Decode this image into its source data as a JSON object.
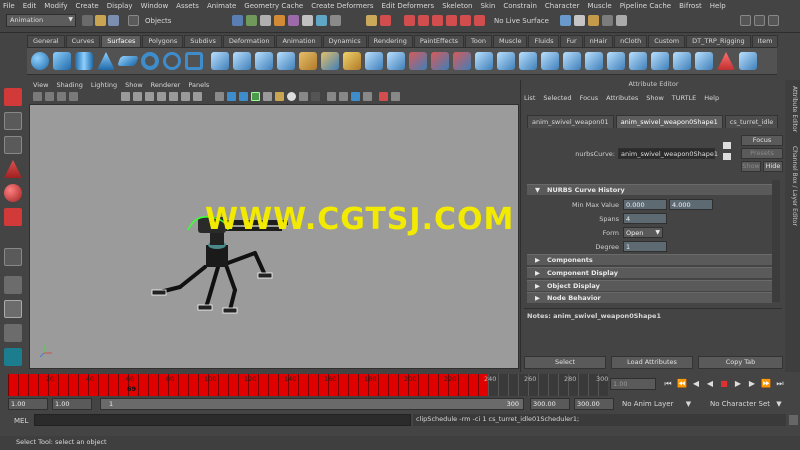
{
  "menubar": [
    "File",
    "Edit",
    "Modify",
    "Create",
    "Display",
    "Window",
    "Assets",
    "Animate",
    "Geometry Cache",
    "Create Deformers",
    "Edit Deformers",
    "Skeleton",
    "Skin",
    "Constrain",
    "Character",
    "Muscle",
    "Pipeline Cache",
    "Bifrost",
    "Help"
  ],
  "status": {
    "mode_menu": "Animation",
    "objects_label": "Objects",
    "live_surface": "No Live Surface"
  },
  "shelf_tabs": [
    "General",
    "Curves",
    "Surfaces",
    "Polygons",
    "Subdivs",
    "Deformation",
    "Animation",
    "Dynamics",
    "Rendering",
    "PaintEffects",
    "Toon",
    "Muscle",
    "Fluids",
    "Fur",
    "nHair",
    "nCloth",
    "Custom",
    "DT_TRP_Rigging",
    "Item"
  ],
  "shelf_active": "Surfaces",
  "viewport_menu": [
    "View",
    "Shading",
    "Lighting",
    "Show",
    "Renderer",
    "Panels"
  ],
  "watermark": "WWW.CGTSJ.COM",
  "attribute_editor": {
    "title": "Attribute Editor",
    "menu": [
      "List",
      "Selected",
      "Focus",
      "Attributes",
      "Show",
      "TURTLE",
      "Help"
    ],
    "tabs": [
      "anim_swivel_weapon01",
      "anim_swivel_weapon0Shape1",
      "cs_turret_idle"
    ],
    "active_tab": "anim_swivel_weapon0Shape1",
    "node_label": "nurbsCurve:",
    "node_value": "anim_swivel_weapon0Shape1",
    "focus_btn": "Focus",
    "presets_btn": "Presets",
    "show_btn": "Show",
    "hide_btn": "Hide",
    "section_history": "NURBS Curve History",
    "minmax_label": "Min Max Value",
    "min_value": "0.000",
    "max_value": "4.000",
    "spans_label": "Spans",
    "spans_value": "4",
    "form_label": "Form",
    "form_value": "Open",
    "degree_label": "Degree",
    "degree_value": "1",
    "sections": [
      "Components",
      "Component Display",
      "Object Display",
      "Node Behavior"
    ],
    "notes": "Notes:  anim_swivel_weapon0Shape1",
    "select_btn": "Select",
    "load_btn": "Load Attributes",
    "copy_btn": "Copy Tab"
  },
  "side_tabs": [
    "Attribute Editor",
    "Channel Box / Layer Editor"
  ],
  "timeline": {
    "labels": [
      "20",
      "40",
      "60",
      "80",
      "100",
      "120",
      "140",
      "160",
      "180",
      "200",
      "220",
      "240",
      "260",
      "280",
      "300"
    ],
    "current_frame": "69",
    "current_field": "1.00"
  },
  "range": {
    "start": "1.00",
    "start2": "1.00",
    "slider_start": "1",
    "slider_end": "300",
    "end": "300.00",
    "end2": "300.00",
    "anim_layer": "No Anim Layer",
    "character_set": "No Character Set"
  },
  "command": {
    "lang": "MEL",
    "result": "clipSchedule -rm -ci 1 cs_turret_idle01Scheduler1;"
  },
  "help_line": "Select Tool: select an object"
}
